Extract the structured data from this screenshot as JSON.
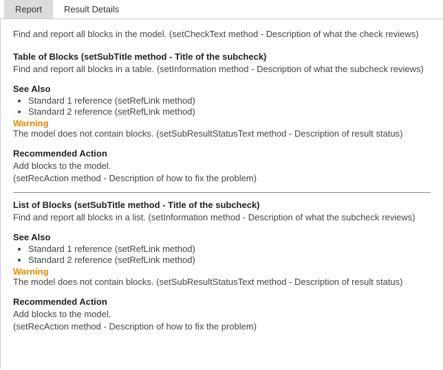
{
  "tabs": {
    "report": "Report",
    "result_details": "Result Details"
  },
  "intro": "Find and report all blocks in the model. (setCheckText method - Description of what the check reviews)",
  "sections": [
    {
      "subtitle": "Table of Blocks (setSubTitle method - Title of the subcheck)",
      "info": "Find and report all blocks in a table. (setInformation method - Description of what the subcheck reviews)",
      "seealso_heading": "See Also",
      "refs": [
        "Standard 1 reference (setRefLink method)",
        "Standard 2 reference (setRefLink method)"
      ],
      "warning_label": "Warning",
      "warning_text": "The model does not contain blocks. (setSubResultStatusText method - Description of result status)",
      "rec_heading": "Recommended Action",
      "rec_line1": "Add blocks to the model.",
      "rec_line2": "(setRecAction method - Description of how to fix the problem)"
    },
    {
      "subtitle": "List of Blocks (setSubTitle method - Title of the subcheck)",
      "info": "Find and report all blocks in a list. (setInformation method - Description of what the subcheck reviews)",
      "seealso_heading": "See Also",
      "refs": [
        "Standard 1 reference (setRefLink method)",
        "Standard 2 reference (setRefLink method)"
      ],
      "warning_label": "Warning",
      "warning_text": "The model does not contain blocks. (setSubResultStatusText method - Description of result status)",
      "rec_heading": "Recommended Action",
      "rec_line1": "Add blocks to the model.",
      "rec_line2": "(setRecAction method - Description of how to fix the problem)"
    }
  ]
}
